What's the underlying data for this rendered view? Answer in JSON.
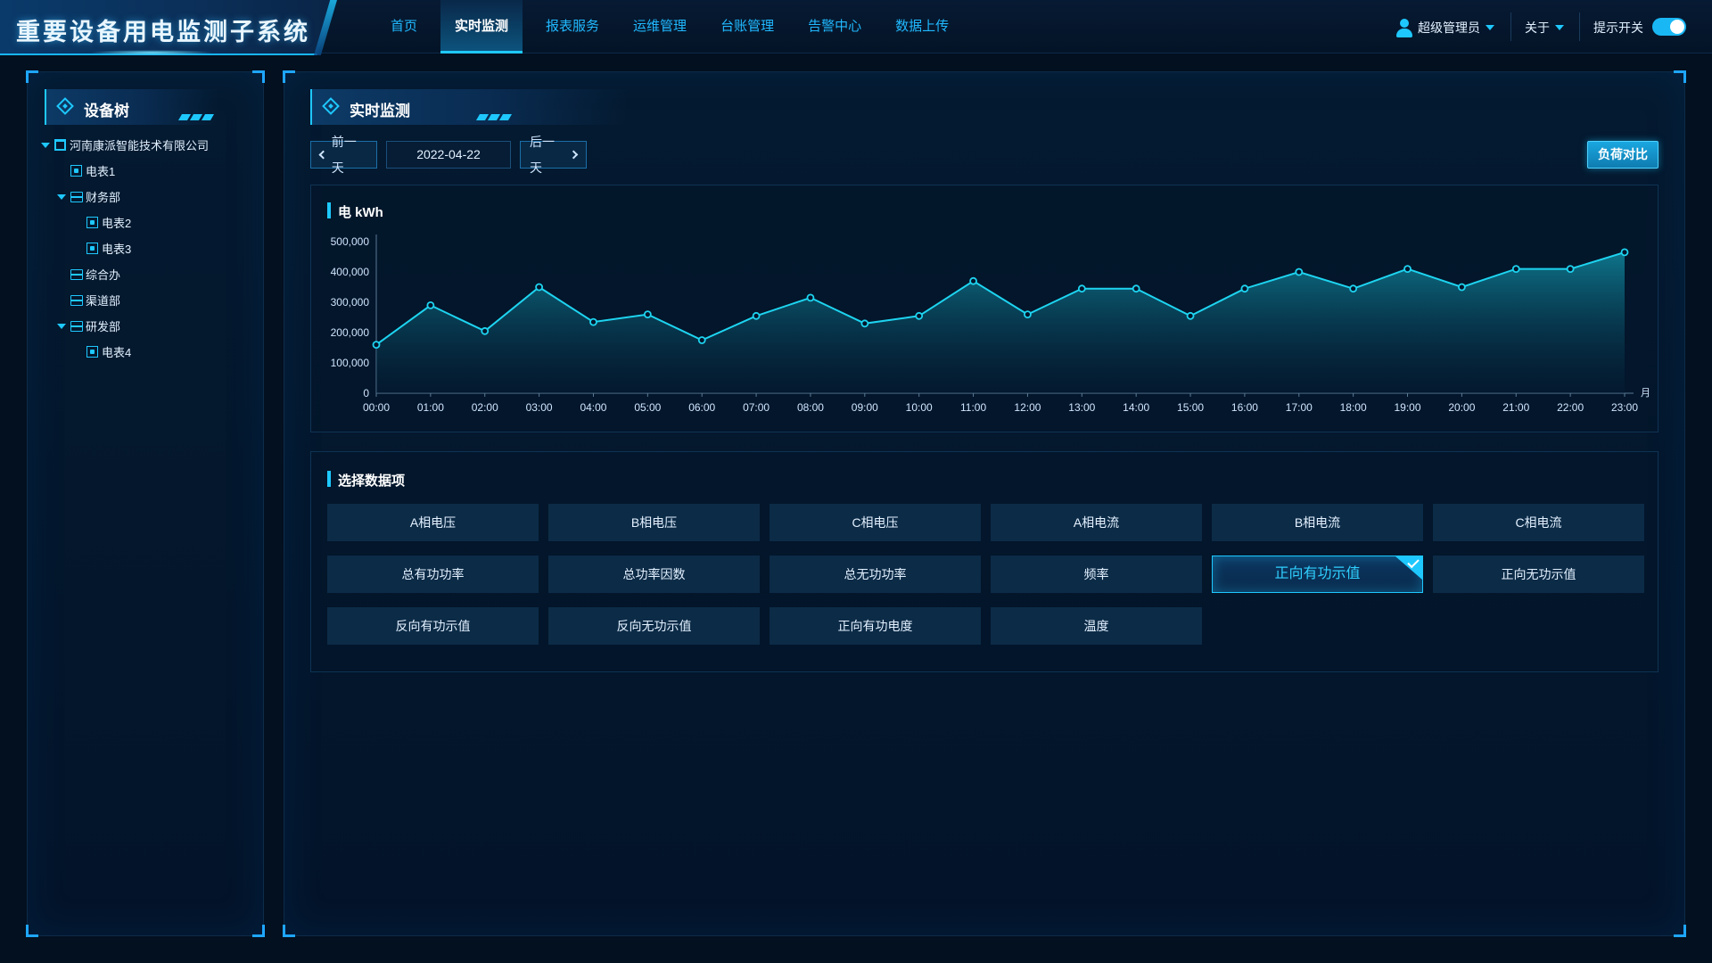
{
  "header": {
    "title": "重要设备用电监测子系统",
    "nav": [
      "首页",
      "实时监测",
      "报表服务",
      "运维管理",
      "台账管理",
      "告警中心",
      "数据上传"
    ],
    "active_nav": 1,
    "user": "超级管理员",
    "about": "关于",
    "toggle_label": "提示开关",
    "toggle_on": true
  },
  "sidebar": {
    "title": "设备树",
    "tree": [
      {
        "label": "河南康派智能技术有限公司",
        "level": 0,
        "icon": "building-icon",
        "expanded": true
      },
      {
        "label": "电表1",
        "level": 1,
        "icon": "meter-icon"
      },
      {
        "label": "财务部",
        "level": 1,
        "icon": "layers-icon",
        "expanded": true
      },
      {
        "label": "电表2",
        "level": 2,
        "icon": "meter-icon"
      },
      {
        "label": "电表3",
        "level": 2,
        "icon": "meter-icon"
      },
      {
        "label": "综合办",
        "level": 1,
        "icon": "layers-icon"
      },
      {
        "label": "渠道部",
        "level": 1,
        "icon": "layers-icon"
      },
      {
        "label": "研发部",
        "level": 1,
        "icon": "layers-icon",
        "expanded": true
      },
      {
        "label": "电表4",
        "level": 2,
        "icon": "meter-icon"
      }
    ]
  },
  "main": {
    "title": "实时监测",
    "prev_day": "前一天",
    "date": "2022-04-22",
    "next_day": "后一天",
    "compare": "负荷对比",
    "items_title": "选择数据项",
    "items": [
      "A相电压",
      "B相电压",
      "C相电压",
      "A相电流",
      "B相电流",
      "C相电流",
      "总有功功率",
      "总功率因数",
      "总无功功率",
      "频率",
      "正向有功示值",
      "正向无功示值",
      "反向有功示值",
      "反向无功示值",
      "正向有功电度",
      "温度"
    ],
    "selected_item": 10
  },
  "chart_data": {
    "type": "area",
    "title": "电 kWh",
    "x_unit": "月",
    "categories": [
      "00:00",
      "01:00",
      "02:00",
      "03:00",
      "04:00",
      "05:00",
      "06:00",
      "07:00",
      "08:00",
      "09:00",
      "10:00",
      "11:00",
      "12:00",
      "13:00",
      "14:00",
      "15:00",
      "16:00",
      "17:00",
      "18:00",
      "19:00",
      "20:00",
      "21:00",
      "22:00",
      "23:00"
    ],
    "values": [
      160000,
      290000,
      205000,
      350000,
      235000,
      260000,
      175000,
      255000,
      315000,
      230000,
      255000,
      370000,
      260000,
      345000,
      345000,
      255000,
      345000,
      400000,
      345000,
      410000,
      350000,
      410000,
      410000,
      465000
    ],
    "ylim": [
      0,
      500000
    ],
    "yticks": [
      "0",
      "100,000",
      "200,000",
      "300,000",
      "400,000",
      "500,000"
    ],
    "colors": {
      "line": "#1ed4f0",
      "area_top": "#0f7f95",
      "area_bottom": "#052038",
      "axis": "#5a7a96"
    }
  }
}
